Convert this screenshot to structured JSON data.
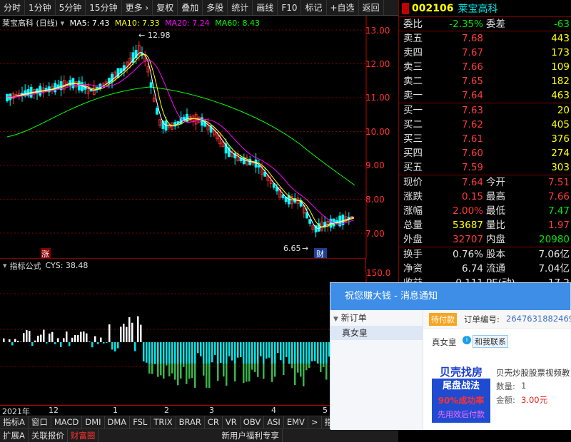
{
  "topbar": {
    "items": [
      "分时",
      "1分钟",
      "5分钟",
      "15分钟",
      "更多",
      "复权",
      "叠加",
      "多股",
      "统计",
      "画线",
      "F10",
      "标记",
      "+自选",
      "返回"
    ]
  },
  "legend": {
    "name": "莱宝高科 (日线)",
    "ma5": "MA5: 7.43",
    "ma10": "MA10: 7.33",
    "ma20": "MA20: 7.24",
    "ma60": "MA60: 8.43"
  },
  "colors": {
    "ma5": "#ffffff",
    "ma10": "#ffff00",
    "ma20": "#ff00ff",
    "ma60": "#00ff00",
    "up": "#ff3030",
    "down": "#00ffff",
    "axis": "#ff0000"
  },
  "price_axis": [
    "13.00",
    "12.00",
    "11.00",
    "10.00",
    "9.00",
    "8.00",
    "7.00"
  ],
  "annotations": {
    "high": "12.98",
    "low": "6.65",
    "up_mark": "涨",
    "cai_mark": "财"
  },
  "indicator": {
    "label": "指标公式",
    "value": "CYS: 38.48",
    "axis_top": "150.0"
  },
  "date_axis": [
    "2021年",
    "12",
    "1",
    "2",
    "3",
    "4",
    "5"
  ],
  "tabs1": [
    "指标A",
    "窗口",
    "MACD",
    "DMI",
    "DMA",
    "FSL",
    "TRIX",
    "BRAR",
    "CR",
    "VR",
    "OBV",
    "ASI",
    "EMV",
    ">",
    "指标"
  ],
  "tabs2": [
    "扩展A",
    "关联报价",
    "财富圈",
    "新用户福利专享"
  ],
  "quote": {
    "code": "002106",
    "name": "莱宝高科",
    "wei_bi_label": "委比",
    "wei_bi": "-2.35%",
    "wei_cha_label": "委差",
    "wei_cha": "-63",
    "asks": [
      {
        "label": "卖五",
        "price": "7.68",
        "vol": "443"
      },
      {
        "label": "卖四",
        "price": "7.67",
        "vol": "173"
      },
      {
        "label": "卖三",
        "price": "7.66",
        "vol": "109"
      },
      {
        "label": "卖二",
        "price": "7.65",
        "vol": "182"
      },
      {
        "label": "卖一",
        "price": "7.64",
        "vol": "463"
      }
    ],
    "bids": [
      {
        "label": "买一",
        "price": "7.63",
        "vol": "20"
      },
      {
        "label": "买二",
        "price": "7.62",
        "vol": "405"
      },
      {
        "label": "买三",
        "price": "7.61",
        "vol": "376"
      },
      {
        "label": "买四",
        "price": "7.60",
        "vol": "274"
      },
      {
        "label": "买五",
        "price": "7.59",
        "vol": "303"
      }
    ],
    "stats": [
      {
        "l1": "现价",
        "v1": "7.64",
        "c1": "red",
        "l2": "今开",
        "v2": "7.51",
        "c2": "red"
      },
      {
        "l1": "涨跌",
        "v1": "0.15",
        "c1": "red",
        "l2": "最高",
        "v2": "7.66",
        "c2": "red"
      },
      {
        "l1": "涨幅",
        "v1": "2.00%",
        "c1": "red",
        "l2": "最低",
        "v2": "7.47",
        "c2": "green"
      },
      {
        "l1": "总量",
        "v1": "53687",
        "c1": "yellow",
        "l2": "量比",
        "v2": "1.97",
        "c2": "red"
      },
      {
        "l1": "外盘",
        "v1": "32707",
        "c1": "red",
        "l2": "内盘",
        "v2": "20980",
        "c2": "green"
      }
    ],
    "stats2": [
      {
        "l1": "换手",
        "v1": "0.76%",
        "l2": "股本",
        "v2": "7.06亿"
      },
      {
        "l1": "净资",
        "v1": "6.74",
        "l2": "流通",
        "v2": "7.04亿"
      },
      {
        "l1": "收益(一)",
        "v1": "0.111",
        "l2": "PE(动)",
        "v2": "17.2"
      }
    ]
  },
  "popup": {
    "title": "祝您赚大钱 - 消息通知",
    "tree_group": "新订单",
    "tree_item": "真女皇",
    "status": "待付款",
    "order_label": "订单编号:",
    "order_no": "2647631882469",
    "buyer": "真女皇",
    "contact": "和我联系",
    "banner_l1": "贝壳找房",
    "banner_l2": "尾盘战法",
    "banner_l3": "90%成功率",
    "banner_l4": "先用效后付款",
    "product": "贝壳炒股股票视频教",
    "qty_label": "数量:",
    "qty": "1",
    "amount_label": "金额:",
    "amount": "3.00元"
  }
}
